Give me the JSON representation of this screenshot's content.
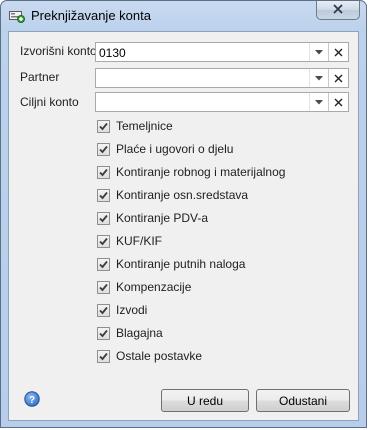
{
  "window": {
    "title": "Preknjižavanje konta"
  },
  "icons": {
    "app": "app-icon",
    "close": "close-icon",
    "dropdown": "chevron-down-icon",
    "clear": "clear-x-icon",
    "help": "help-icon",
    "check": "checkmark-icon"
  },
  "fields": [
    {
      "label": "Izvorišni konto",
      "value": "0130"
    },
    {
      "label": "Partner",
      "value": ""
    },
    {
      "label": "Ciljni konto",
      "value": ""
    }
  ],
  "checkboxes": [
    {
      "label": "Temeljnice",
      "checked": true
    },
    {
      "label": "Plaće i ugovori o djelu",
      "checked": true
    },
    {
      "label": "Kontiranje robnog i materijalnog",
      "checked": true
    },
    {
      "label": "Kontiranje osn.sredstava",
      "checked": true
    },
    {
      "label": "Kontiranje PDV-a",
      "checked": true
    },
    {
      "label": "KUF/KIF",
      "checked": true
    },
    {
      "label": "Kontiranje putnih naloga",
      "checked": true
    },
    {
      "label": "Kompenzacije",
      "checked": true
    },
    {
      "label": "Izvodi",
      "checked": true
    },
    {
      "label": "Blagajna",
      "checked": true
    },
    {
      "label": "Ostale postavke",
      "checked": true
    }
  ],
  "buttons": {
    "ok": "U redu",
    "cancel": "Odustani"
  },
  "colors": {
    "frame": "#b7cde9",
    "client": "#f0f0f0",
    "check": "#3c3c3c"
  }
}
